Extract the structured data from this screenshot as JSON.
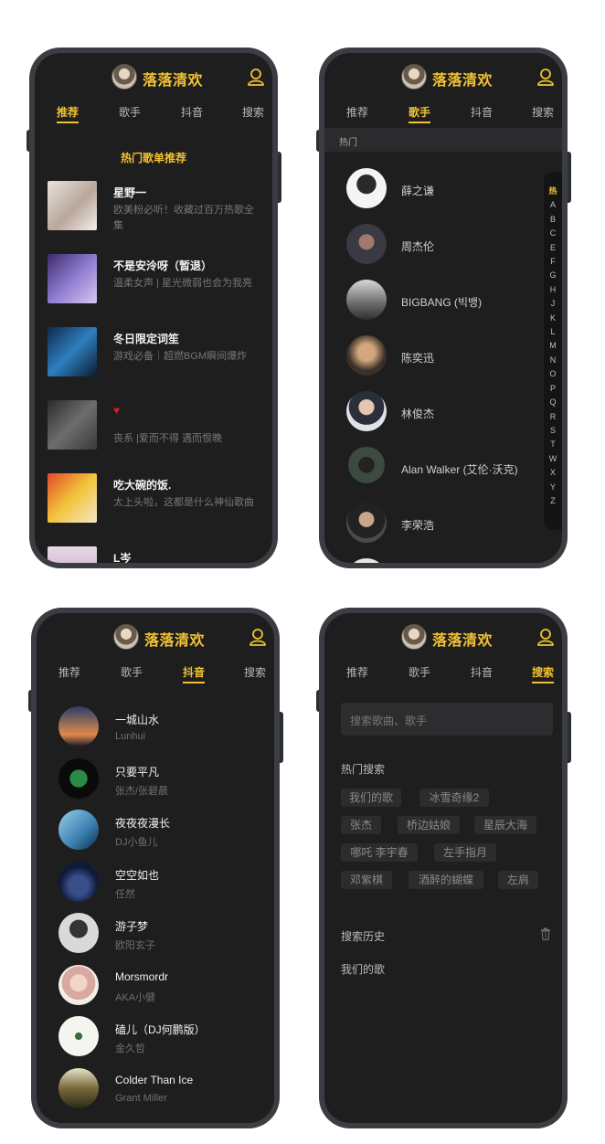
{
  "app": {
    "title": "落落清欢"
  },
  "tabs": [
    "推荐",
    "歌手",
    "抖音",
    "搜索"
  ],
  "recommend": {
    "section_title": "热门歌单推荐",
    "items": [
      {
        "name": "星野一",
        "desc": "欧美粉必听！收藏过百万热歌全集"
      },
      {
        "name": "不是安泠呀（暂退）",
        "desc": "温柔女声 | 星光微弱也会为我亮"
      },
      {
        "name": "冬日限定词笙",
        "desc": "游戏必备｜超燃BGM瞬间爆炸"
      },
      {
        "name": "♥",
        "desc": "丧系 |爱而不得 遇而恨晚"
      },
      {
        "name": "吃大碗的饭.",
        "desc": "太上头啦，这都是什么神仙歌曲"
      },
      {
        "name": "L岑",
        "desc": ""
      }
    ]
  },
  "singers": {
    "hot_label": "热门",
    "list": [
      "薛之谦",
      "周杰伦",
      "BIGBANG (빅뱅)",
      "陈奕迅",
      "林俊杰",
      "Alan Walker (艾伦·沃克)",
      "李荣浩"
    ],
    "alphabet": [
      "热",
      "A",
      "B",
      "C",
      "E",
      "F",
      "G",
      "H",
      "J",
      "K",
      "L",
      "M",
      "N",
      "O",
      "P",
      "Q",
      "R",
      "S",
      "T",
      "W",
      "X",
      "Y",
      "Z"
    ]
  },
  "douyin": {
    "items": [
      {
        "name": "一城山水",
        "artist": "Lunhui"
      },
      {
        "name": "只要平凡",
        "artist": "张杰/张碧晨"
      },
      {
        "name": "夜夜夜漫长",
        "artist": "DJ小鱼儿"
      },
      {
        "name": "空空如也",
        "artist": "任然"
      },
      {
        "name": "游子梦",
        "artist": "欧阳玄子"
      },
      {
        "name": "Morsmordr",
        "artist": "AKA小健"
      },
      {
        "name": "磕儿（DJ何鹏版）",
        "artist": "金久哲"
      },
      {
        "name": "Colder Than Ice",
        "artist": "Grant Miller"
      }
    ]
  },
  "search": {
    "placeholder": "搜索歌曲、歌手",
    "hot_label": "热门搜索",
    "tags": [
      "我们的歌",
      "冰雪奇缘2",
      "张杰",
      "桥边姑娘",
      "星辰大海",
      "哪吒 李宇春",
      "左手指月",
      "邓紫棋",
      "酒醉的蝴蝶",
      "左肩"
    ],
    "history_label": "搜索历史",
    "history": [
      "我们的歌"
    ]
  },
  "colors": {
    "accent": "#f1c232",
    "background": "#1e1e1f",
    "frame": "#3a3d42"
  }
}
